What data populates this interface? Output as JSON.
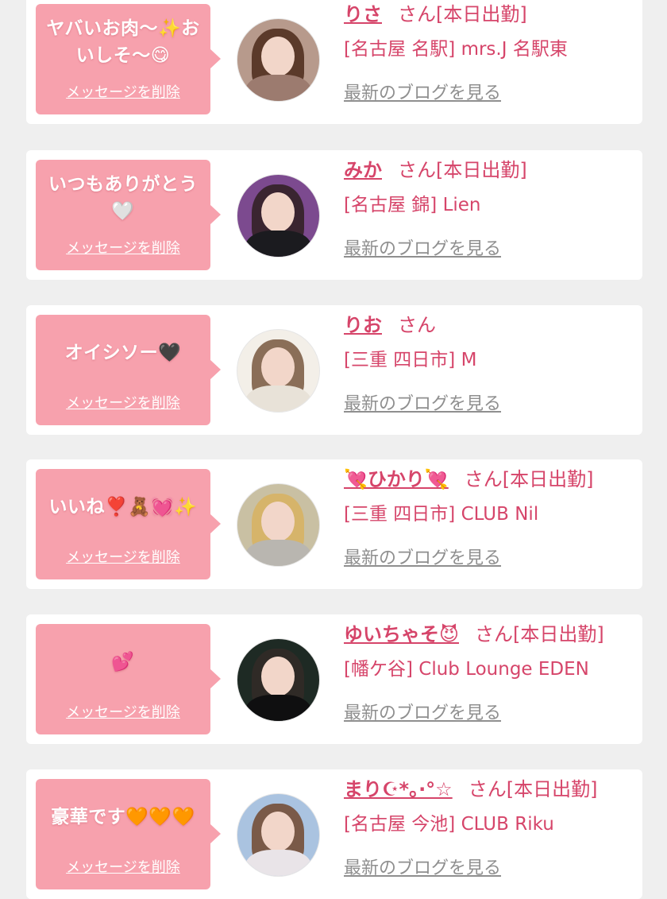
{
  "cards": [
    {
      "message": "ヤバいお肉〜✨おいしそ〜😋",
      "delete_label": "メッセージを削除",
      "name": "りさ",
      "suffix": "さん[本日出勤]",
      "shop": "[名古屋 名駅] mrs.J 名駅東",
      "blog_label": "最新のブログを見る",
      "avatar_bg": "#b79a8c",
      "hair_color": "#5b3a2a",
      "body_color": "#9c7b6f"
    },
    {
      "message": "いつもありがとう🤍",
      "delete_label": "メッセージを削除",
      "name": "みか",
      "suffix": "さん[本日出勤]",
      "shop": "[名古屋 錦] Lien",
      "blog_label": "最新のブログを見る",
      "avatar_bg": "#7c4a8f",
      "hair_color": "#3a2530",
      "body_color": "#1b1b1f"
    },
    {
      "message": "オイシソー🖤",
      "delete_label": "メッセージを削除",
      "name": "りお",
      "suffix": "さん",
      "shop": "[三重 四日市] M",
      "blog_label": "最新のブログを見る",
      "avatar_bg": "#f3efe8",
      "hair_color": "#8a6e58",
      "body_color": "#e8e2d8"
    },
    {
      "message": "いいね❣️🧸💓✨",
      "delete_label": "メッセージを削除",
      "name": "💘ひかり💘",
      "suffix": "さん[本日出勤]",
      "shop": "[三重 四日市] CLUB Nil",
      "blog_label": "最新のブログを見る",
      "avatar_bg": "#c9c0a3",
      "hair_color": "#d6b46a",
      "body_color": "#b9b6b0"
    },
    {
      "message": "💕",
      "delete_label": "メッセージを削除",
      "name": "ゆいちゃそ😈",
      "suffix": "さん[本日出勤]",
      "shop": "[幡ケ谷] Club Lounge EDEN",
      "blog_label": "最新のブログを見る",
      "avatar_bg": "#1e2a24",
      "hair_color": "#2f2a26",
      "body_color": "#0f0f10"
    },
    {
      "message": "豪華です🧡🧡🧡",
      "delete_label": "メッセージを削除",
      "name": "まり☪︎*。·°☆",
      "suffix": "さん[本日出勤]",
      "shop": "[名古屋 今池] CLUB Riku",
      "blog_label": "最新のブログを見る",
      "avatar_bg": "#aac3e0",
      "hair_color": "#7a5a48",
      "body_color": "#e9e4e8"
    }
  ]
}
